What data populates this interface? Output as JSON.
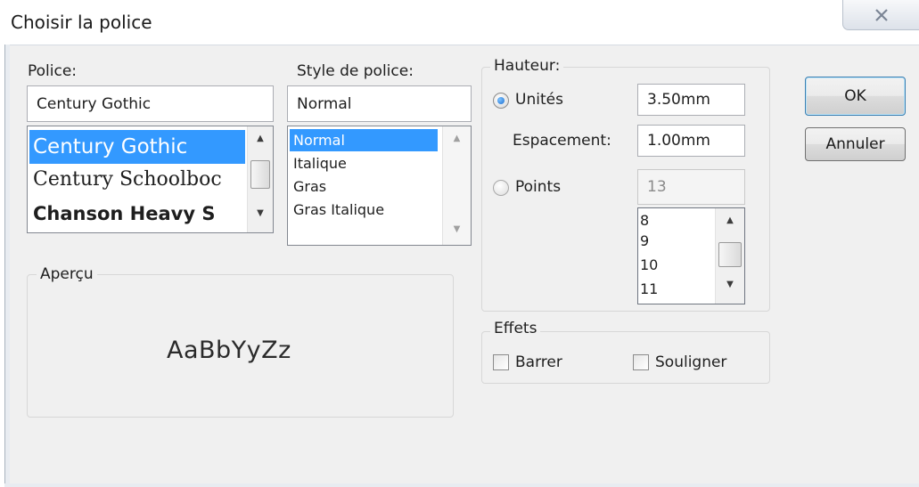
{
  "window": {
    "title": "Choisir la police",
    "close_icon": "close-x-icon"
  },
  "font": {
    "label": "Police:",
    "value": "Century Gothic",
    "options": [
      "Century Gothic",
      "Century Schoolboc",
      "Chanson Heavy S"
    ],
    "selected_index": 0
  },
  "style": {
    "label": "Style de police:",
    "value": "Normal",
    "options": [
      "Normal",
      "Italique",
      "Gras",
      "Gras Italique"
    ],
    "selected_index": 0
  },
  "height": {
    "group_label": "Hauteur:",
    "units_label": "Unités",
    "units_selected": true,
    "units_value": "3.50mm",
    "spacing_label": "Espacement:",
    "spacing_value": "1.00mm",
    "points_label": "Points",
    "points_selected": false,
    "points_value": "13",
    "points_options": [
      "8",
      "9",
      "10",
      "11"
    ]
  },
  "preview": {
    "group_label": "Aperçu",
    "sample_text": "AaBbYyZz"
  },
  "effects": {
    "group_label": "Effets",
    "strike_label": "Barrer",
    "strike_checked": false,
    "underline_label": "Souligner",
    "underline_checked": false
  },
  "buttons": {
    "ok_label": "OK",
    "cancel_label": "Annuler"
  },
  "colors": {
    "selection": "#3399ff",
    "radio_selected": "#1d6fd1",
    "dialog_bg": "#f0f0f0"
  }
}
